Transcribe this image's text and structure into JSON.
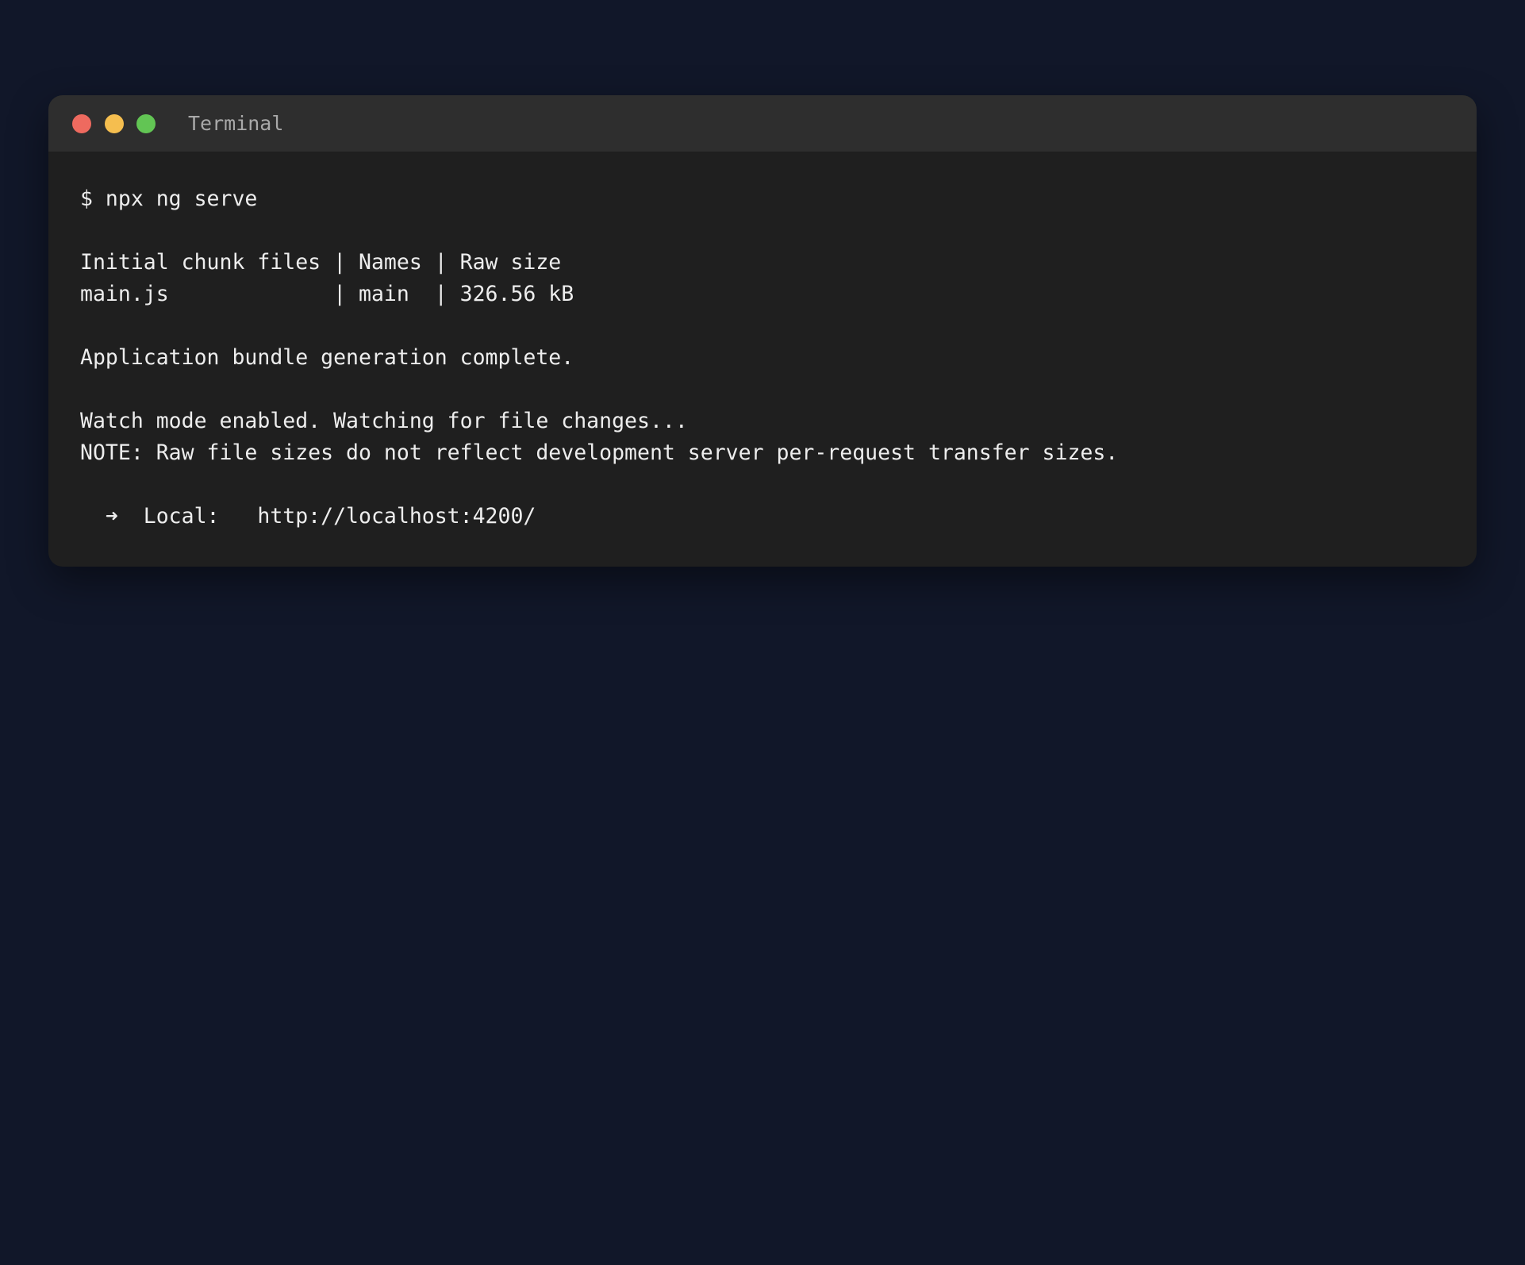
{
  "window": {
    "title": "Terminal",
    "controls": {
      "close_color": "#ee6a5f",
      "minimize_color": "#f5be4f",
      "zoom_color": "#62c554"
    }
  },
  "terminal": {
    "lines": [
      "$ npx ng serve",
      "",
      "Initial chunk files | Names | Raw size",
      "main.js             | main  | 326.56 kB",
      "",
      "Application bundle generation complete.",
      "",
      "Watch mode enabled. Watching for file changes...",
      "NOTE: Raw file sizes do not reflect development server per-request transfer sizes.",
      "",
      "  ➜  Local:   http://localhost:4200/"
    ]
  }
}
